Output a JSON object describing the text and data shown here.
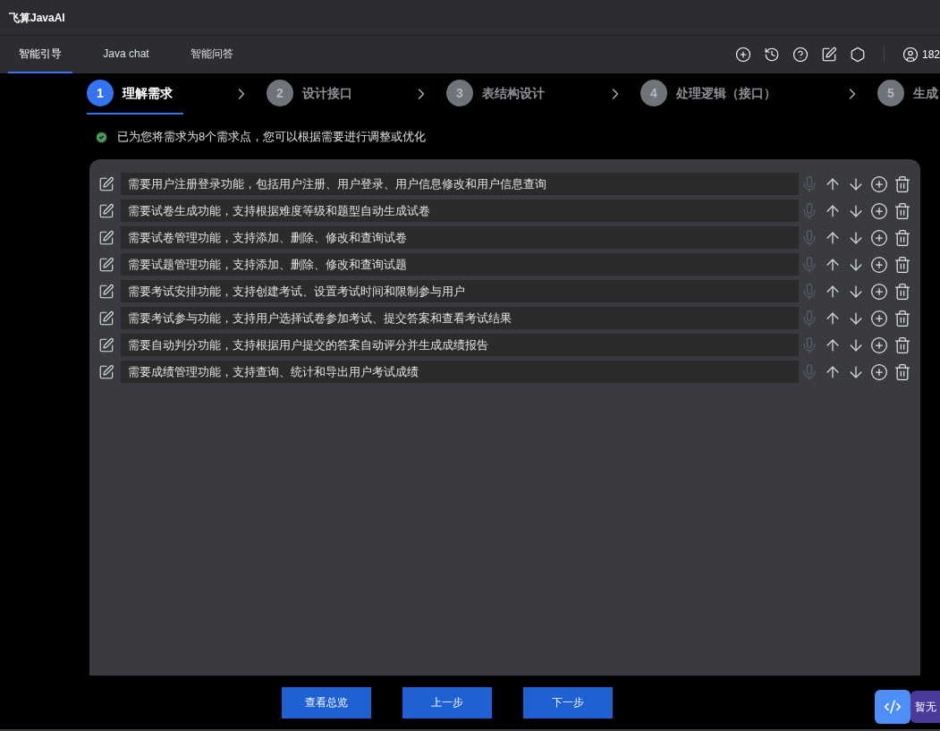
{
  "window": {
    "title": "飞算JavaAI"
  },
  "tabs": [
    {
      "label": "智能引导",
      "selected": true
    },
    {
      "label": "Java chat",
      "selected": false
    },
    {
      "label": "智能问答",
      "selected": false
    }
  ],
  "user": {
    "label": "182"
  },
  "steps": [
    {
      "number": "1",
      "label": "理解需求",
      "selected": true
    },
    {
      "number": "2",
      "label": "设计接口",
      "selected": false
    },
    {
      "number": "3",
      "label": "表结构设计",
      "selected": false
    },
    {
      "number": "4",
      "label": "处理逻辑（接口）",
      "selected": false
    },
    {
      "number": "5",
      "label": "生成",
      "selected": false
    }
  ],
  "message": "已为您将需求为8个需求点，您可以根据需要进行调整或优化",
  "requirements": [
    {
      "text": "需要用户注册登录功能，包括用户注册、用户登录、用户信息修改和用户信息查询",
      "mic_disabled": true
    },
    {
      "text": "需要试卷生成功能，支持根据难度等级和题型自动生成试卷",
      "mic_disabled": true
    },
    {
      "text": "需要试卷管理功能，支持添加、删除、修改和查询试卷",
      "mic_disabled": true
    },
    {
      "text": "需要试题管理功能，支持添加、删除、修改和查询试题",
      "mic_disabled": true
    },
    {
      "text": "需要考试安排功能，支持创建考试、设置考试时间和限制参与用户",
      "mic_disabled": true
    },
    {
      "text": "需要考试参与功能，支持用户选择试卷参加考试、提交答案和查看考试结果",
      "mic_disabled": true
    },
    {
      "text": "需要自动判分功能，支持根据用户提交的答案自动评分并生成成绩报告",
      "mic_disabled": true
    },
    {
      "text": "需要成绩管理功能，支持查询、统计和导出用户考试成绩",
      "mic_disabled": true
    }
  ],
  "buttons": [
    "查看总览",
    "上一步",
    "下一步"
  ],
  "floating_label": "暂无"
}
